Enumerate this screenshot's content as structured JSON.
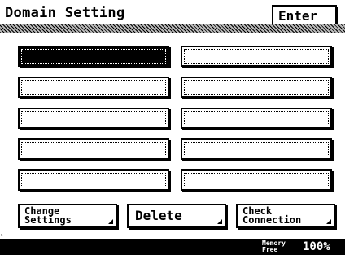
{
  "header": {
    "title": "Domain Setting",
    "enter_label": "Enter"
  },
  "domain_slots": [
    {
      "label": "",
      "selected": true
    },
    {
      "label": "",
      "selected": false
    },
    {
      "label": "",
      "selected": false
    },
    {
      "label": "",
      "selected": false
    },
    {
      "label": "",
      "selected": false
    },
    {
      "label": "",
      "selected": false
    },
    {
      "label": "",
      "selected": false
    },
    {
      "label": "",
      "selected": false
    },
    {
      "label": "",
      "selected": false
    },
    {
      "label": "",
      "selected": false
    }
  ],
  "buttons": {
    "change_settings_line1": "Change",
    "change_settings_line2": "Settings",
    "delete": "Delete",
    "check_connection_line1": "Check",
    "check_connection_line2": "Connection"
  },
  "footer": {
    "mark": "¹",
    "memory_line1": "Memory",
    "memory_line2": "Free",
    "memory_value": "100%"
  },
  "colors": {
    "background": "#ffffff",
    "ink": "#000000",
    "selected_slot": "#000000"
  }
}
